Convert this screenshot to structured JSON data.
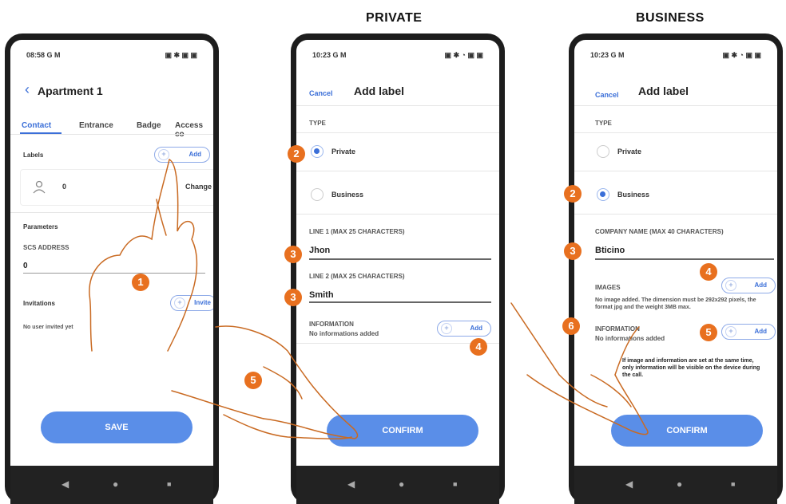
{
  "headings": {
    "private": "PRIVATE",
    "business": "BUSINESS"
  },
  "phone1": {
    "time": "08:58 G M",
    "status_icons": "▣ ✱ ▣ ▣",
    "back_icon": "chevron-left-icon",
    "title": "Apartment 1",
    "tabs": [
      "Contact",
      "Entrance",
      "Badge",
      "Access co"
    ],
    "labels_title": "Labels",
    "add_label": "Add",
    "label_count": "0",
    "change_label": "Change",
    "parameters_title": "Parameters",
    "scs_label": "SCS ADDRESS",
    "scs_value": "0",
    "invitations_title": "Invitations",
    "invite_label": "Invite",
    "no_invite": "No user invited yet",
    "save_label": "SAVE"
  },
  "phone2": {
    "time": "10:23 G M",
    "status_icons": "▣ ✱ ◔ ▣ ▣",
    "cancel": "Cancel",
    "title": "Add label",
    "type_label": "TYPE",
    "private": "Private",
    "business": "Business",
    "selected": "Private",
    "line1_label": "LINE 1 (MAX 25 CHARACTERS)",
    "line1_value": "Jhon",
    "line2_label": "LINE 2 (MAX 25 CHARACTERS)",
    "line2_value": "Smith",
    "information_label": "INFORMATION",
    "information_empty": "No informations added",
    "add_label": "Add",
    "confirm_label": "CONFIRM"
  },
  "phone3": {
    "time": "10:23 G M",
    "status_icons": "▣ ✱ ◔ ▣ ▣",
    "cancel": "Cancel",
    "title": "Add label",
    "type_label": "TYPE",
    "private": "Private",
    "business": "Business",
    "selected": "Business",
    "company_label": "COMPANY NAME (MAX 40 CHARACTERS)",
    "company_value": "Bticino",
    "images_label": "IMAGES",
    "images_hint": "No image added. The dimension must be 292x292 pixels, the format jpg and the weight 3MB max.",
    "information_label": "INFORMATION",
    "information_empty": "No informations added",
    "note": "If image and information are set at the same time, only information will be visible on the device during the call.",
    "add_label": "Add",
    "confirm_label": "CONFIRM"
  },
  "nav": {
    "back": "◀",
    "home": "●",
    "recent": "■"
  },
  "callouts": [
    "1",
    "2",
    "3",
    "3",
    "4",
    "5",
    "2",
    "3",
    "4",
    "5",
    "6"
  ],
  "colors": {
    "accent": "#5a8ee8",
    "link": "#3b6fd8",
    "callout": "#e8701f",
    "hand": "#c96a22"
  }
}
